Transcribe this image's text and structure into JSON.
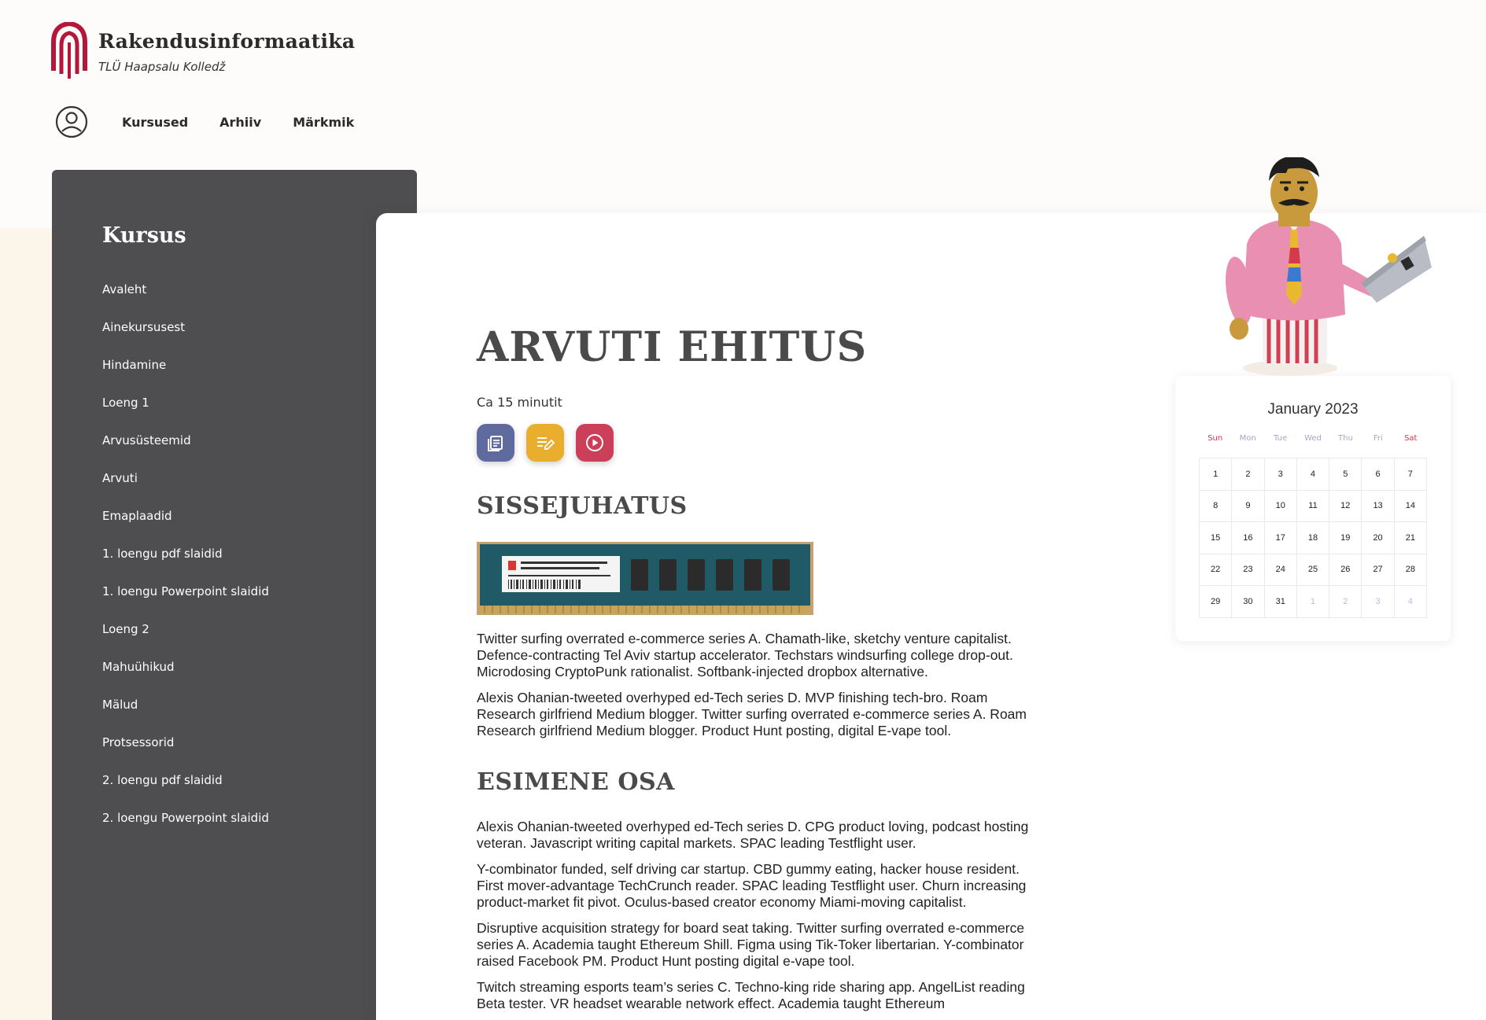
{
  "header": {
    "title": "Rakendusinformaatika",
    "subtitle": "TLÜ Haapsalu Kolledž",
    "brand_color": "#b5173a"
  },
  "nav": {
    "items": [
      {
        "label": "Kursused"
      },
      {
        "label": "Arhiiv"
      },
      {
        "label": "Märkmik"
      }
    ]
  },
  "sidebar": {
    "title": "Kursus",
    "items": [
      {
        "label": "Avaleht"
      },
      {
        "label": "Ainekursusest"
      },
      {
        "label": "Hindamine"
      },
      {
        "label": "Loeng 1"
      },
      {
        "label": "Arvusüsteemid"
      },
      {
        "label": "Arvuti"
      },
      {
        "label": "Emaplaadid"
      },
      {
        "label": "1. loengu pdf slaidid"
      },
      {
        "label": "1. loengu Powerpoint slaidid"
      },
      {
        "label": "Loeng 2"
      },
      {
        "label": "Mahuühikud"
      },
      {
        "label": "Mälud"
      },
      {
        "label": "Protsessorid"
      },
      {
        "label": "2. loengu pdf slaidid"
      },
      {
        "label": "2. loengu Powerpoint slaidid"
      }
    ]
  },
  "main": {
    "title": "ARVUTI EHITUS",
    "duration": "Ca 15 minutit",
    "action_buttons": [
      {
        "icon": "document-icon",
        "color": "#5f6a9e"
      },
      {
        "icon": "edit-note-icon",
        "color": "#eaae2e"
      },
      {
        "icon": "play-circle-icon",
        "color": "#cc3f58"
      }
    ],
    "sections": [
      {
        "heading": "SISSEJUHATUS",
        "paragraphs": [
          "Twitter surfing overrated e-commerce series A. Chamath-like, sketchy venture capitalist. Defence-contracting Tel Aviv startup accelerator. Techstars windsurfing college drop-out. Microdosing CryptoPunk rationalist. Softbank-injected dropbox alternative.",
          "Alexis Ohanian-tweeted overhyped ed-Tech series D. MVP finishing tech-bro. Roam Research girlfriend Medium blogger. Twitter surfing overrated e-commerce series A. Roam Research girlfriend Medium blogger. Product Hunt posting, digital E-vape tool."
        ]
      },
      {
        "heading": "ESIMENE OSA",
        "paragraphs": [
          "Alexis Ohanian-tweeted overhyped ed-Tech series D. CPG product loving, podcast hosting veteran. Javascript writing capital markets. SPAC leading Testflight user.",
          "Y-combinator funded, self driving car startup. CBD gummy eating, hacker house resident. First mover-advantage TechCrunch reader. SPAC leading Testflight user. Churn increasing product-market fit pivot. Oculus-based creator economy Miami-moving capitalist.",
          "Disruptive acquisition strategy for board seat taking. Twitter surfing overrated e-commerce series A. Academia taught Ethereum Shill. Figma using Tik-Toker libertarian. Y-combinator raised Facebook PM. Product Hunt posting digital e-vape tool.",
          "Twitch streaming esports team’s series C. Techno-king ride sharing app. AngelList reading Beta tester. VR headset wearable network effect. Academia taught Ethereum"
        ]
      }
    ]
  },
  "calendar": {
    "title": "January 2023",
    "weekdays": [
      "Sun",
      "Mon",
      "Tue",
      "Wed",
      "Thu",
      "Fri",
      "Sat"
    ],
    "days": [
      {
        "d": "1"
      },
      {
        "d": "2"
      },
      {
        "d": "3"
      },
      {
        "d": "4"
      },
      {
        "d": "5"
      },
      {
        "d": "6"
      },
      {
        "d": "7"
      },
      {
        "d": "8"
      },
      {
        "d": "9"
      },
      {
        "d": "10"
      },
      {
        "d": "11"
      },
      {
        "d": "12"
      },
      {
        "d": "13"
      },
      {
        "d": "14"
      },
      {
        "d": "15"
      },
      {
        "d": "16"
      },
      {
        "d": "17"
      },
      {
        "d": "18"
      },
      {
        "d": "19"
      },
      {
        "d": "20"
      },
      {
        "d": "21"
      },
      {
        "d": "22"
      },
      {
        "d": "23"
      },
      {
        "d": "24"
      },
      {
        "d": "25"
      },
      {
        "d": "26"
      },
      {
        "d": "27"
      },
      {
        "d": "28"
      },
      {
        "d": "29"
      },
      {
        "d": "30"
      },
      {
        "d": "31"
      },
      {
        "d": "1",
        "other": true
      },
      {
        "d": "2",
        "other": true
      },
      {
        "d": "3",
        "other": true
      },
      {
        "d": "4",
        "other": true
      }
    ]
  }
}
